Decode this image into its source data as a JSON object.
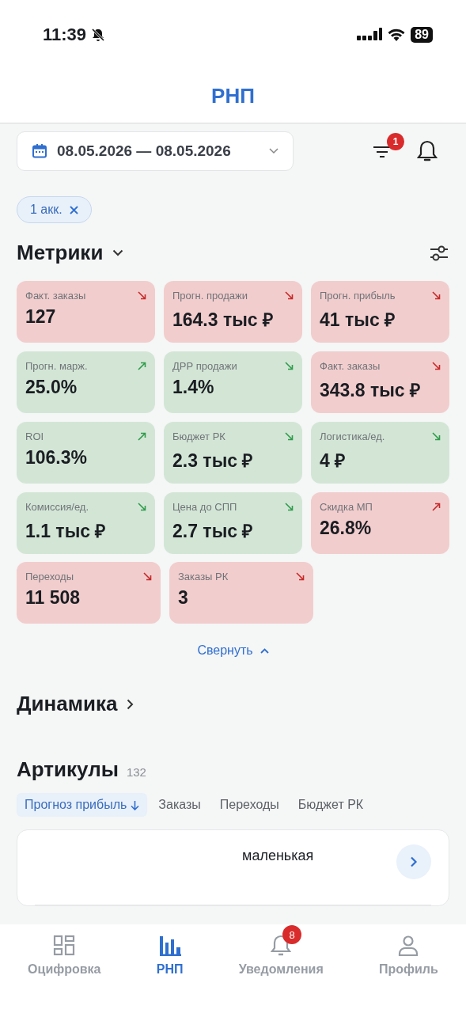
{
  "status_bar": {
    "time": "11:39",
    "battery": "89"
  },
  "header": {
    "title": "РНП"
  },
  "date_range": {
    "value": "08.05.2026 — 08.05.2026"
  },
  "filter_badge": "1",
  "chips": [
    {
      "label": "1 акк."
    }
  ],
  "metrics_section": {
    "title": "Метрики",
    "collapse_label": "Свернуть"
  },
  "metrics": [
    {
      "label": "Факт. заказы",
      "value": "127",
      "positive": false,
      "rising": false
    },
    {
      "label": "Прогн. продажи",
      "value": "164.3 тыс ₽",
      "positive": false,
      "rising": false
    },
    {
      "label": "Прогн. прибыль",
      "value": "41 тыс ₽",
      "positive": false,
      "rising": false
    },
    {
      "label": "Прогн. марж.",
      "value": "25.0%",
      "positive": true,
      "rising": true
    },
    {
      "label": "ДРР продажи",
      "value": "1.4%",
      "positive": true,
      "rising": false
    },
    {
      "label": "Факт. заказы",
      "value": "343.8 тыс ₽",
      "positive": false,
      "rising": false
    },
    {
      "label": "ROI",
      "value": "106.3%",
      "positive": true,
      "rising": true
    },
    {
      "label": "Бюджет РК",
      "value": "2.3 тыс ₽",
      "positive": true,
      "rising": false
    },
    {
      "label": "Логистика/ед.",
      "value": "4 ₽",
      "positive": true,
      "rising": false
    },
    {
      "label": "Комиссия/ед.",
      "value": "1.1 тыс ₽",
      "positive": true,
      "rising": false
    },
    {
      "label": "Цена до СПП",
      "value": "2.7 тыс ₽",
      "positive": true,
      "rising": false
    },
    {
      "label": "Скидка МП",
      "value": "26.8%",
      "positive": false,
      "rising": true
    },
    {
      "label": "Переходы",
      "value": "11 508",
      "positive": false,
      "rising": false
    },
    {
      "label": "Заказы РК",
      "value": "3",
      "positive": false,
      "rising": false
    }
  ],
  "dynamics": {
    "title": "Динамика"
  },
  "articles": {
    "title": "Артикулы",
    "count": "132",
    "sort_tabs": [
      {
        "label": "Прогноз прибыль",
        "selected": true
      },
      {
        "label": "Заказы",
        "selected": false
      },
      {
        "label": "Переходы",
        "selected": false
      },
      {
        "label": "Бюджет РК",
        "selected": false
      }
    ],
    "items": [
      {
        "title": "маленькая"
      }
    ]
  },
  "bottom_nav": [
    {
      "label": "Оцифровка",
      "kind": "grid",
      "selected": false
    },
    {
      "label": "РНП",
      "kind": "chart",
      "selected": true
    },
    {
      "label": "Уведомления",
      "kind": "bell",
      "selected": false,
      "badge": "8"
    },
    {
      "label": "Профиль",
      "kind": "person",
      "selected": false
    }
  ]
}
